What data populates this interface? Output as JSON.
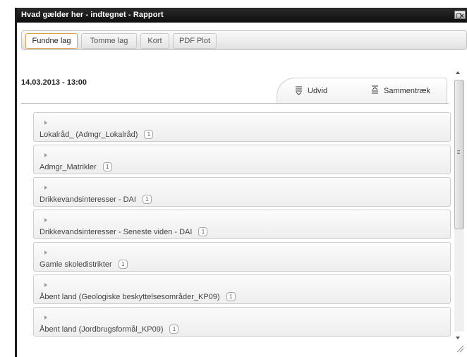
{
  "window": {
    "title": "Hvad gælder her - indtegnet - Rapport"
  },
  "tabs": [
    {
      "label": "Fundne lag",
      "active": true
    },
    {
      "label": "Tomme lag",
      "active": false
    },
    {
      "label": "Kort",
      "active": false
    },
    {
      "label": "PDF Plot",
      "active": false
    }
  ],
  "report": {
    "datetime": "14.03.2013 - 13:00",
    "expand_label": "Udvid",
    "collapse_label": "Sammentræk",
    "expand_icon": "expand-all-icon",
    "collapse_icon": "collapse-all-icon"
  },
  "layers": [
    {
      "name": "Lokalråd_ (Admgr_Lokalråd)",
      "count": "1"
    },
    {
      "name": "Admgr_Matrikler",
      "count": "1"
    },
    {
      "name": "Drikkevandsinteresser - DAI",
      "count": "1"
    },
    {
      "name": "Drikkevandsinteresser - Seneste viden - DAI",
      "count": "1"
    },
    {
      "name": "Gamle skoledistrikter",
      "count": "1"
    },
    {
      "name": "Åbent land (Geologiske beskyttelsesområder_KP09)",
      "count": "1"
    },
    {
      "name": "Åbent land (Jordbrugsformål_KP09)",
      "count": "1"
    }
  ],
  "colors": {
    "titlebar": "#1a1a1a",
    "active_tab_border": "#e0a04b",
    "item_border": "#cdcdcd"
  }
}
